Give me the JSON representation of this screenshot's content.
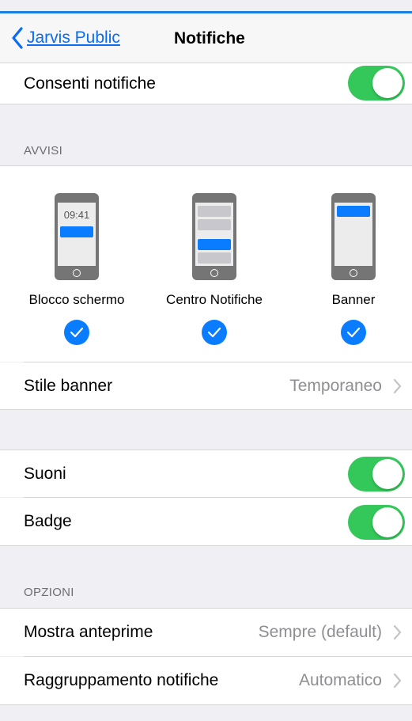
{
  "nav": {
    "back_label": "Jarvis Public",
    "title": "Notifiche"
  },
  "allow": {
    "label": "Consenti notifiche",
    "enabled": true
  },
  "alerts_section": {
    "header": "AVVISI",
    "options": [
      {
        "label": "Blocco schermo",
        "time": "09:41",
        "checked": true
      },
      {
        "label": "Centro Notifiche",
        "checked": true
      },
      {
        "label": "Banner",
        "checked": true
      }
    ]
  },
  "banner_style": {
    "label": "Stile banner",
    "value": "Temporaneo"
  },
  "sounds": {
    "label": "Suoni",
    "enabled": true
  },
  "badge": {
    "label": "Badge",
    "enabled": true
  },
  "options_section": {
    "header": "OPZIONI",
    "previews": {
      "label": "Mostra anteprime",
      "value": "Sempre (default)"
    },
    "grouping": {
      "label": "Raggruppamento notifiche",
      "value": "Automatico"
    }
  },
  "colors": {
    "accent": "#0a6cf2",
    "toggle_on": "#34c759",
    "background": "#efeff4",
    "secondary_text": "#8e8e93"
  }
}
